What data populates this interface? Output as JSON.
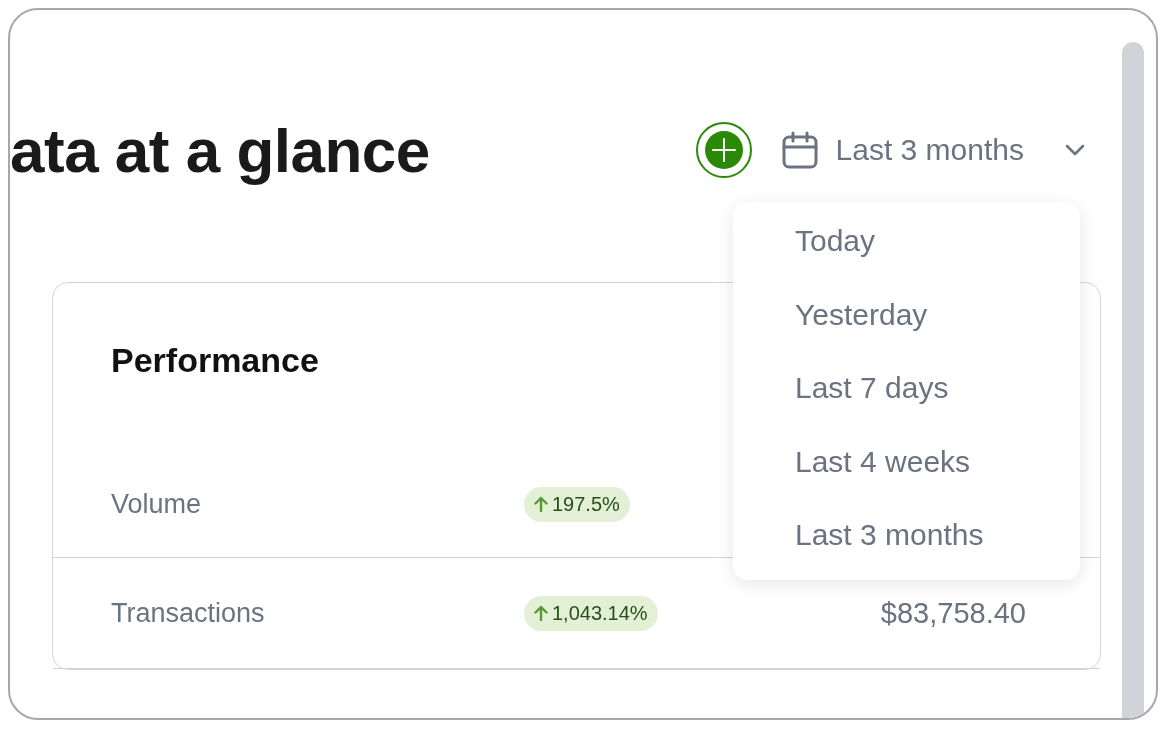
{
  "title": "ata at a glance",
  "date_range": {
    "label": "Last 3 months",
    "expanded": true
  },
  "date_menu": [
    "Today",
    "Yesterday",
    "Last 7 days",
    "Last 4 weeks",
    "Last 3 months"
  ],
  "card": {
    "title": "Performance",
    "rows": [
      {
        "label": "Volume",
        "change": "197.5%",
        "rising": true
      },
      {
        "label": "Transactions",
        "change": "1,043.14%",
        "rising": true,
        "amount": "$83,758.40"
      }
    ]
  }
}
